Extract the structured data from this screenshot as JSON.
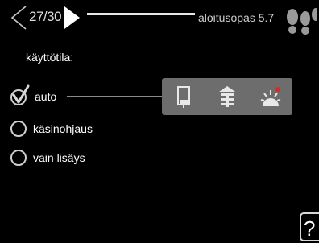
{
  "header": {
    "counter": "27/30",
    "title": "aloitusopas 5.7",
    "prev_icon": "chevron-left-icon",
    "next_icon": "play-right-icon",
    "guide_icon": "footprints-icon"
  },
  "main": {
    "section_label": "käyttötila:",
    "options": [
      {
        "label": "auto",
        "selected": true
      },
      {
        "label": "käsinohjaus",
        "selected": false
      },
      {
        "label": "vain lisäys",
        "selected": false
      }
    ],
    "mode_icons": [
      "hot-water-tank-icon",
      "heating-radiator-icon",
      "sun-icon"
    ]
  },
  "footer": {
    "help_icon": "question-icon"
  },
  "colors": {
    "background": "#000000",
    "text": "#ffffff",
    "panel": "#6d6d6d"
  }
}
